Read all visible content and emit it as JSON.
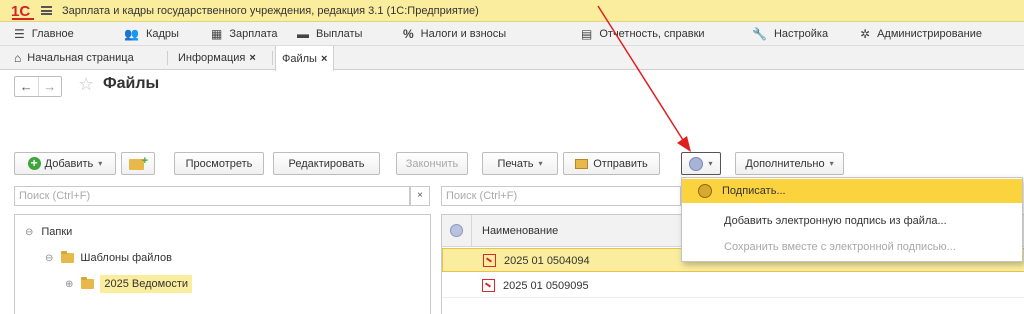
{
  "app": {
    "logo": "1С",
    "title": "Зарплата и кадры государственного учреждения, редакция 3.1  (1С:Предприятие)"
  },
  "menu": [
    {
      "label": "Главное",
      "icon": "hamburger-icon"
    },
    {
      "label": "Кадры",
      "icon": "people-icon"
    },
    {
      "label": "Зарплата",
      "icon": "calculator-icon"
    },
    {
      "label": "Выплаты",
      "icon": "money-icon"
    },
    {
      "label": "Налоги и взносы",
      "icon": "percent-icon"
    },
    {
      "label": "Отчетность, справки",
      "icon": "report-icon"
    },
    {
      "label": "Настройка",
      "icon": "wrench-icon"
    },
    {
      "label": "Администрирование",
      "icon": "gear-icon"
    }
  ],
  "tabs": [
    {
      "label": "Начальная страница",
      "icon": "home-icon"
    },
    {
      "label": "Информация",
      "close": "×"
    },
    {
      "label": "Файлы",
      "close": "×"
    }
  ],
  "page": {
    "title": "Файлы",
    "back": "←",
    "forward": "→",
    "star": "☆"
  },
  "toolbar": {
    "add": "Добавить",
    "view": "Просмотреть",
    "edit": "Редактировать",
    "finish": "Закончить",
    "print": "Печать",
    "send": "Отправить",
    "more": "Дополнительно",
    "caret": "▾"
  },
  "search": {
    "left_placeholder": "Поиск (Ctrl+F)",
    "right_placeholder": "Поиск (Ctrl+F)",
    "clear": "×"
  },
  "tree": {
    "root": "Папки",
    "child": "Шаблоны файлов",
    "grandchild": "2025 Ведомости",
    "collapse_symbol": "⊖",
    "expand_symbol": "⊕"
  },
  "grid": {
    "column": "Наименование",
    "rows": [
      "2025 01 0504094",
      "2025 01 0509095"
    ]
  },
  "signature_menu": {
    "items": [
      "Подписать...",
      "Добавить электронную подпись из файла...",
      "Сохранить вместе с электронной подписью..."
    ]
  },
  "colors": {
    "accent_yellow": "#fbed9e",
    "highlight": "#fbd33e",
    "arrow": "#e02020",
    "logo_red": "#d4212a"
  }
}
